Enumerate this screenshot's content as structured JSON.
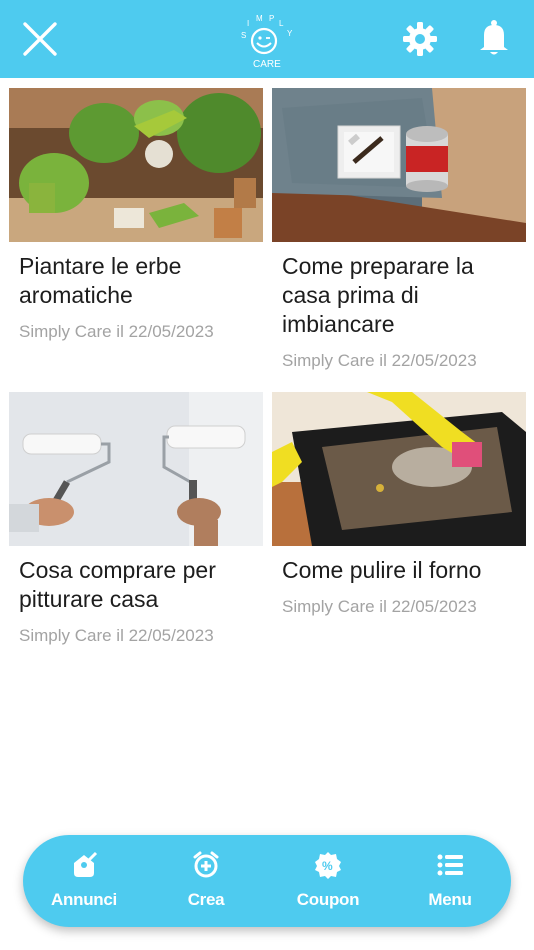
{
  "header": {
    "logo_text_top": "SIMPLY",
    "logo_text_bottom": "CARE",
    "icons": [
      "close-icon",
      "gear-icon",
      "bell-icon"
    ],
    "background": "#4ecbef"
  },
  "articles": [
    {
      "title": "Piantare le erbe aromatiche",
      "meta": "Simply Care il 22/05/2023",
      "image": "herbs-and-pots"
    },
    {
      "title": "Come preparare la casa prima di imbiancare",
      "meta": "Simply Care il 22/05/2023",
      "image": "paint-tray-and-can"
    },
    {
      "title": "Cosa comprare per pitturare casa",
      "meta": "Simply Care il 22/05/2023",
      "image": "paint-rollers"
    },
    {
      "title": "Come pulire il forno",
      "meta": "Simply Care il 22/05/2023",
      "image": "oven-cleaning"
    }
  ],
  "bottom_nav": {
    "items": [
      {
        "label": "Annunci",
        "icon": "tag-edit-icon"
      },
      {
        "label": "Crea",
        "icon": "alarm-plus-icon"
      },
      {
        "label": "Coupon",
        "icon": "percent-badge-icon"
      },
      {
        "label": "Menu",
        "icon": "list-icon"
      }
    ]
  }
}
